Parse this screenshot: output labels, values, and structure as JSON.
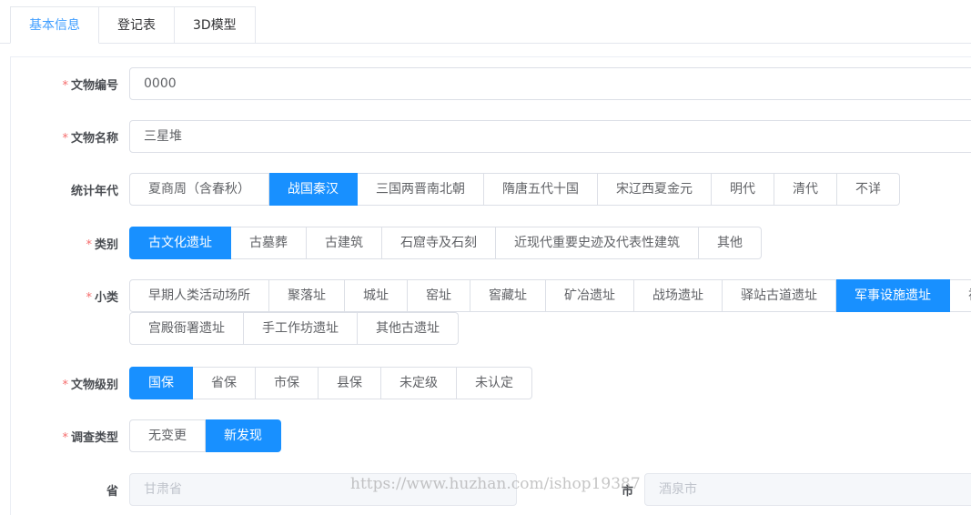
{
  "tabs": [
    {
      "label": "基本信息",
      "active": true
    },
    {
      "label": "登记表",
      "active": false
    },
    {
      "label": "3D模型",
      "active": false
    }
  ],
  "form": {
    "code": {
      "label": "文物编号",
      "required": true,
      "value": "0000"
    },
    "name": {
      "label": "文物名称",
      "required": true,
      "value": "三星堆"
    },
    "era": {
      "label": "统计年代",
      "required": false,
      "options": [
        "夏商周（含春秋）",
        "战国秦汉",
        "三国两晋南北朝",
        "隋唐五代十国",
        "宋辽西夏金元",
        "明代",
        "清代",
        "不详"
      ],
      "selected": "战国秦汉"
    },
    "category": {
      "label": "类别",
      "required": true,
      "options": [
        "古文化遗址",
        "古墓葬",
        "古建筑",
        "石窟寺及石刻",
        "近现代重要史迹及代表性建筑",
        "其他"
      ],
      "selected": "古文化遗址"
    },
    "subcategory": {
      "label": "小类",
      "required": true,
      "options_row1": [
        "早期人类活动场所",
        "聚落址",
        "城址",
        "窑址",
        "窖藏址",
        "矿冶遗址",
        "战场遗址",
        "驿站古道遗址",
        "军事设施遗址",
        "祠"
      ],
      "options_row2": [
        "宫殿衙署遗址",
        "手工作坊遗址",
        "其他古遗址"
      ],
      "selected": "军事设施遗址"
    },
    "level": {
      "label": "文物级别",
      "required": true,
      "options": [
        "国保",
        "省保",
        "市保",
        "县保",
        "未定级",
        "未认定"
      ],
      "selected": "国保"
    },
    "survey_type": {
      "label": "调查类型",
      "required": true,
      "options": [
        "无变更",
        "新发现"
      ],
      "selected": "新发现"
    },
    "province": {
      "label": "省",
      "value": "甘肃省"
    },
    "city": {
      "label": "市",
      "value": "酒泉市"
    }
  },
  "watermark": "https://www.huzhan.com/ishop19387",
  "colors": {
    "accent": "#1890ff",
    "tab_active": "#409eff",
    "required": "#f56c6c"
  }
}
